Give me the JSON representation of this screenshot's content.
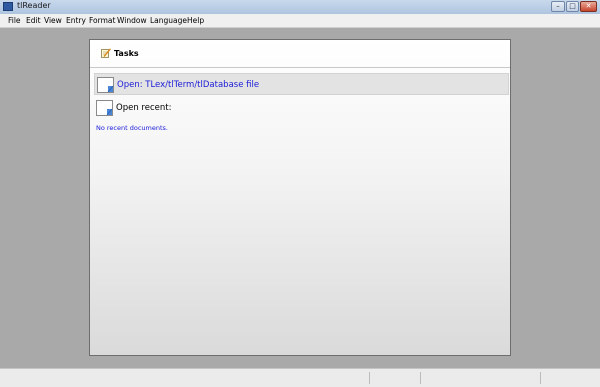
{
  "window": {
    "title": "tlReader"
  },
  "window_buttons": {
    "minimize": "–",
    "maximize": "□",
    "close": "✕"
  },
  "menu": [
    "File",
    "Edit",
    "View",
    "Entry",
    "Format",
    "Window",
    "Language",
    "Help"
  ],
  "tasks_panel": {
    "title": "Tasks",
    "open_label": "Open: TLex/tlTerm/tlDatabase file",
    "open_recent_label": "Open recent:",
    "no_recent_text": "No recent documents."
  },
  "icons": {
    "tasks": "pencil-notepad-icon",
    "open": "document-icon",
    "recent": "document-icon"
  }
}
